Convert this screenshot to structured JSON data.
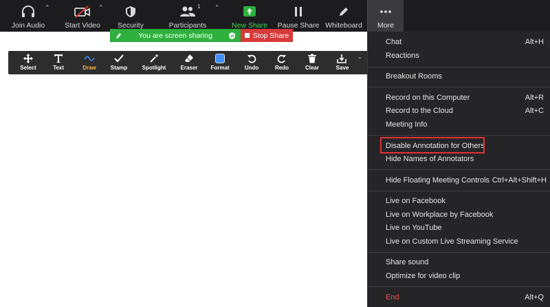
{
  "toolbar": {
    "join_audio": "Join Audio",
    "start_video": "Start Video",
    "security": "Security",
    "participants": "Participants",
    "participants_count": "1",
    "new_share": "New Share",
    "pause_share": "Pause Share",
    "whiteboard": "Whiteboard",
    "more": "More"
  },
  "share_status": {
    "sharing": "You are screen sharing",
    "stop": "Stop Share"
  },
  "annotation": {
    "select": "Select",
    "text": "Text",
    "draw": "Draw",
    "stamp": "Stamp",
    "spotlight": "Spotlight",
    "eraser": "Eraser",
    "format": "Format",
    "undo": "Undo",
    "redo": "Redo",
    "clear": "Clear",
    "save": "Save"
  },
  "menu": {
    "chat": {
      "label": "Chat",
      "shortcut": "Alt+H"
    },
    "reactions": {
      "label": "Reactions"
    },
    "breakout_rooms": {
      "label": "Breakout Rooms"
    },
    "record_computer": {
      "label": "Record on this Computer",
      "shortcut": "Alt+R"
    },
    "record_cloud": {
      "label": "Record to the Cloud",
      "shortcut": "Alt+C"
    },
    "meeting_info": {
      "label": "Meeting Info"
    },
    "disable_annotation": {
      "label": "Disable Annotation for Others"
    },
    "hide_names": {
      "label": "Hide Names of Annotators"
    },
    "hide_floating": {
      "label": "Hide Floating Meeting Controls",
      "shortcut": "Ctrl+Alt+Shift+H"
    },
    "live_facebook": {
      "label": "Live on Facebook"
    },
    "live_workplace": {
      "label": "Live on Workplace by Facebook"
    },
    "live_youtube": {
      "label": "Live on YouTube"
    },
    "live_custom": {
      "label": "Live on Custom Live Streaming Service"
    },
    "share_sound": {
      "label": "Share sound"
    },
    "optimize_video": {
      "label": "Optimize for video clip"
    },
    "end": {
      "label": "End",
      "shortcut": "Alt+Q"
    }
  },
  "colors": {
    "toolbar_bg": "#1c1c1e",
    "menu_bg": "#252527",
    "new_share_green": "#2eb13d",
    "stop_red": "#d73a3a",
    "end_red": "#e8504f",
    "highlight_red": "#e0323a",
    "draw_active": "#ffb23a",
    "format_blue": "#3d8ef7"
  },
  "icons": [
    "headphone-icon",
    "video-off-icon",
    "shield-icon",
    "participants-icon",
    "share-arrow-icon",
    "pause-icon",
    "pen-icon",
    "more-dots-icon",
    "move-icon",
    "text-icon",
    "draw-wave-icon",
    "check-icon",
    "spotlight-wand-icon",
    "eraser-icon",
    "format-square-icon",
    "undo-icon",
    "redo-icon",
    "trash-icon",
    "save-download-icon"
  ]
}
